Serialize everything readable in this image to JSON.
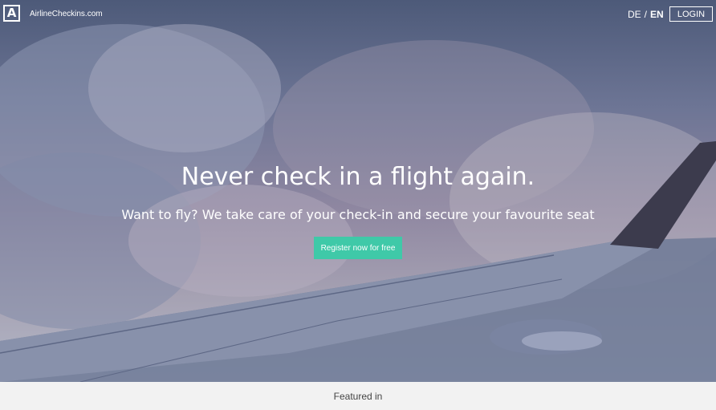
{
  "header": {
    "logo_letter": "A",
    "site_name": "AirlineCheckins.com",
    "languages": [
      {
        "label": "DE",
        "active": false
      },
      {
        "label": "/",
        "active": false
      },
      {
        "label": "EN",
        "active": true
      }
    ],
    "login_label": "LOGIN"
  },
  "hero": {
    "headline": "Never check in a flight again.",
    "subheadline": "Want to fly? We take care of your check-in and secure your favourite seat",
    "cta_label": "Register now for free"
  },
  "footer": {
    "featured_label": "Featured in"
  },
  "colors": {
    "accent": "#3fc9a8",
    "text_on_hero": "#ffffff",
    "footer_bg": "#f2f2f2"
  }
}
